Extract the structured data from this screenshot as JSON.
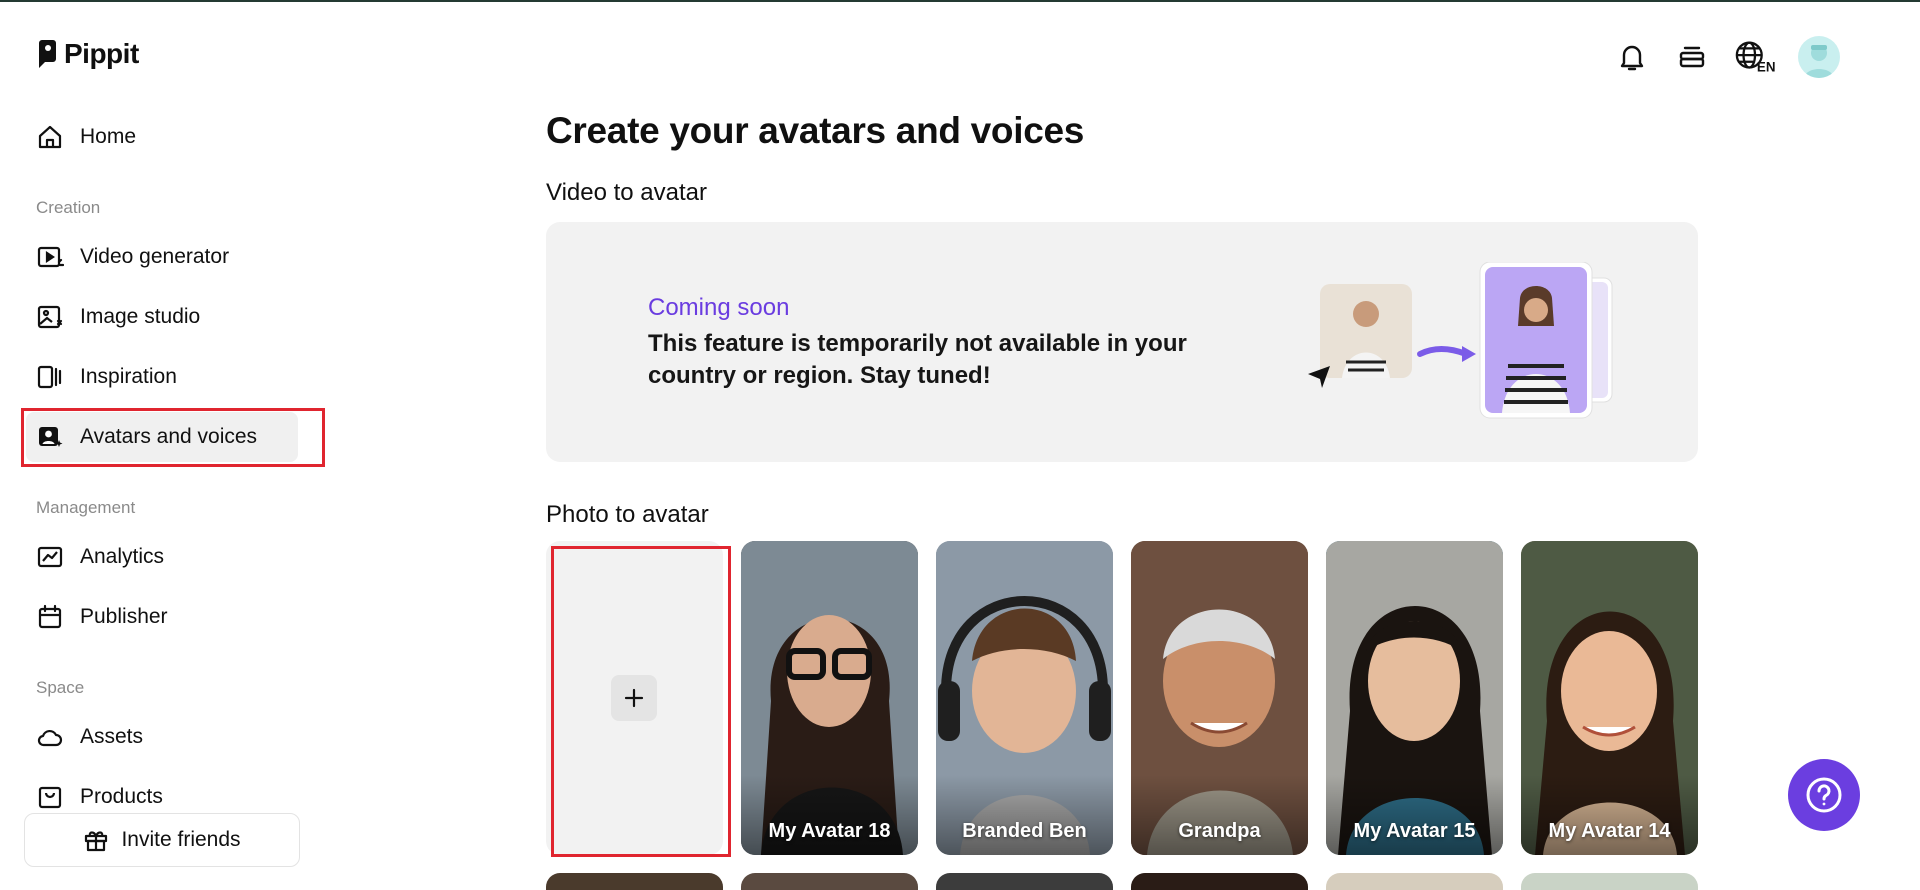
{
  "app": {
    "logo_text": "Pippit"
  },
  "sidebar": {
    "home": "Home",
    "creation_label": "Creation",
    "video_generator": "Video generator",
    "image_studio": "Image studio",
    "inspiration": "Inspiration",
    "avatars_voices": "Avatars and voices",
    "management_label": "Management",
    "analytics": "Analytics",
    "publisher": "Publisher",
    "space_label": "Space",
    "assets": "Assets",
    "products": "Products",
    "invite_friends": "Invite friends"
  },
  "header": {
    "icons": [
      "bell-icon",
      "layers-icon",
      "globe-language-icon",
      "user-avatar"
    ],
    "language": "EN"
  },
  "main": {
    "title": "Create your avatars and voices",
    "video_to_avatar": {
      "heading": "Video to avatar",
      "status": "Coming soon",
      "message": "This feature is temporarily not available in your country or region. Stay tuned!"
    },
    "photo_to_avatar": {
      "heading": "Photo to avatar",
      "avatars": [
        {
          "name": "My Avatar 18",
          "bg": "#2b2b2b"
        },
        {
          "name": "Branded Ben",
          "bg": "#7f8fa0"
        },
        {
          "name": "Grandpa",
          "bg": "#8a6a4f"
        },
        {
          "name": "My Avatar 15",
          "bg": "#2f6c86"
        },
        {
          "name": "My Avatar 14",
          "bg": "#a08a70"
        }
      ]
    }
  },
  "colors": {
    "accent": "#6b3ee0",
    "highlight": "#e0252f",
    "coming_soon": "#6a3ce0"
  }
}
